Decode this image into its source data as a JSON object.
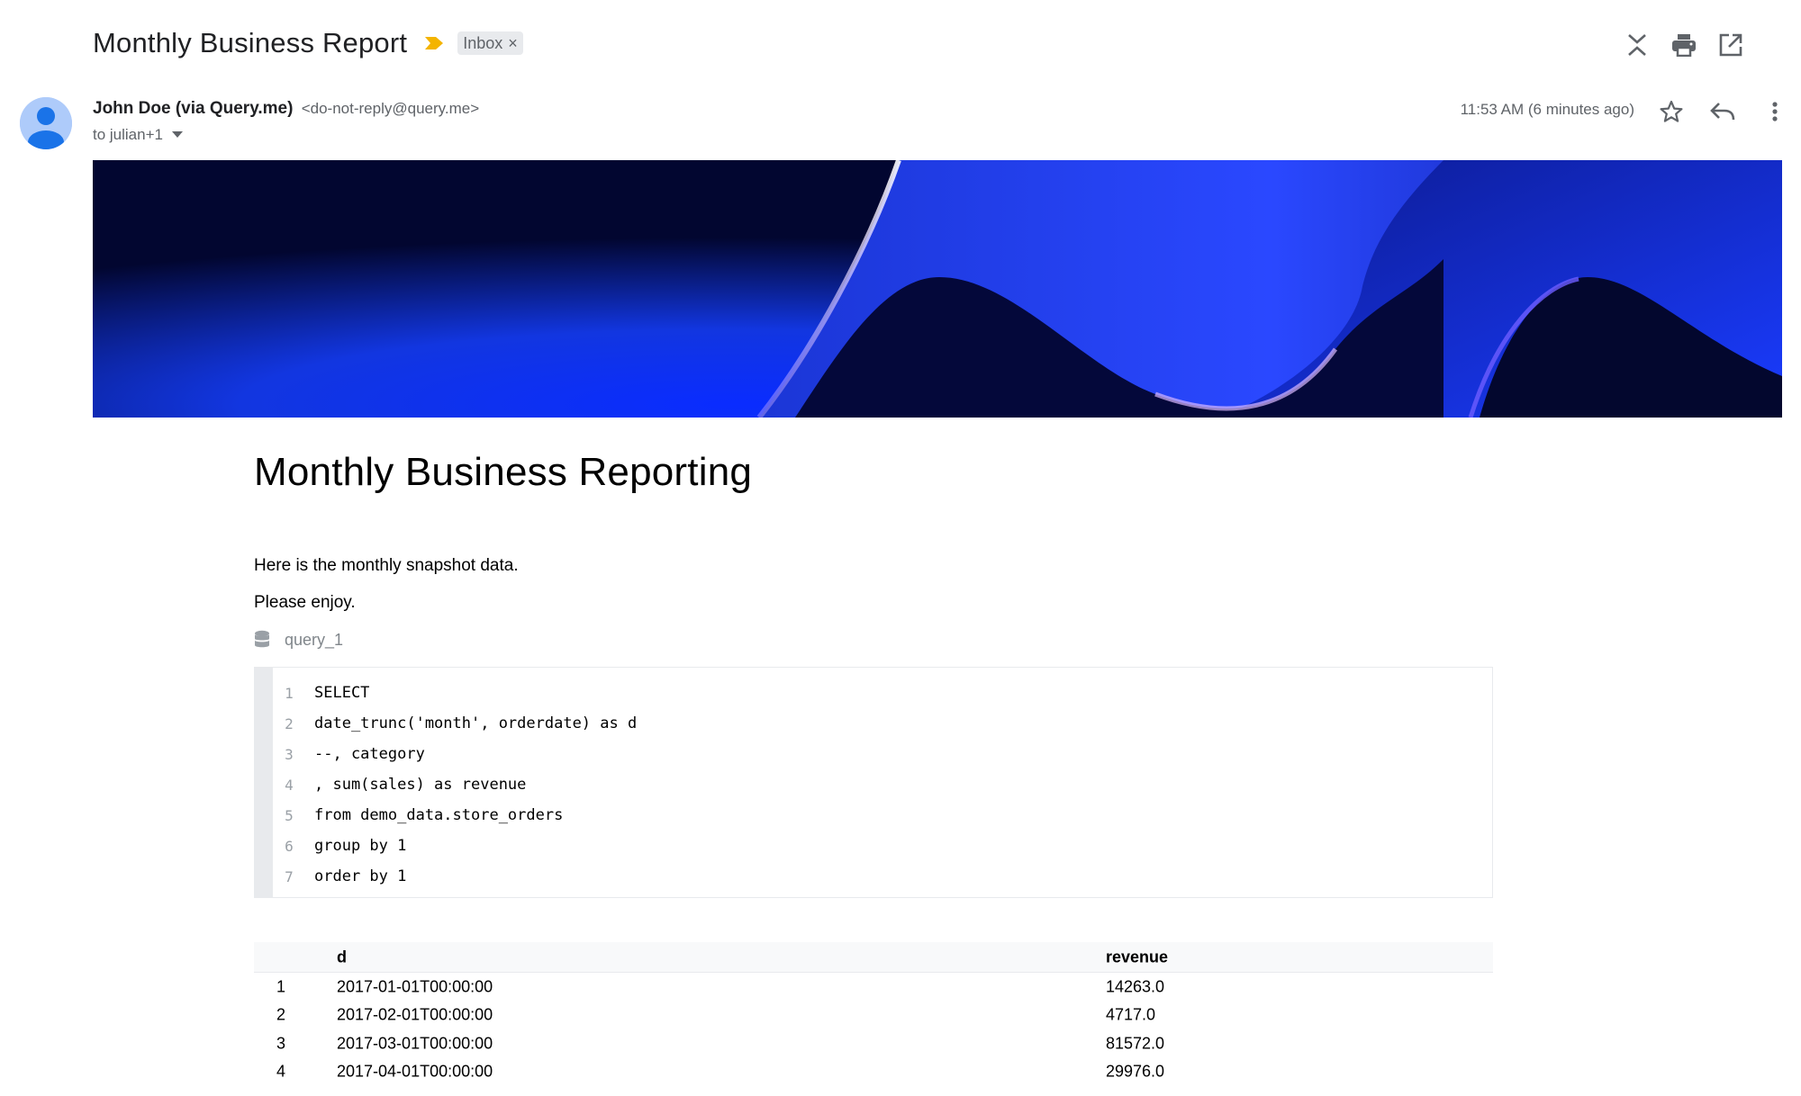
{
  "email": {
    "subject": "Monthly Business Report",
    "label_chip": "Inbox",
    "sender_name": "John Doe (via Query.me)",
    "sender_email": "<do-not-reply@query.me>",
    "recipients": "to julian+1",
    "timestamp": "11:53 AM (6 minutes ago)"
  },
  "icons": {
    "top": [
      "collapse-all-icon",
      "print-icon",
      "open-in-new-window-icon"
    ],
    "header": [
      "star-icon",
      "reply-icon",
      "more-vert-icon"
    ]
  },
  "colors": {
    "importance_marker": "#f4b400",
    "avatar_bg": "#aecbfa",
    "avatar_fg": "#1a73e8",
    "banner_dark": "#030a3a",
    "banner_bright": "#1438ff"
  },
  "body": {
    "heading": "Monthly Business Reporting",
    "intro": "Here is the monthly snapshot data.",
    "closing": "Please enjoy.",
    "query_name": "query_1",
    "code_lines": [
      {
        "num": "1",
        "text": "SELECT"
      },
      {
        "num": "2",
        "text": "date_trunc('month', orderdate) as d"
      },
      {
        "num": "3",
        "text": "--, category"
      },
      {
        "num": "4",
        "text": ", sum(sales) as revenue"
      },
      {
        "num": "5",
        "text": "from demo_data.store_orders"
      },
      {
        "num": "6",
        "text": "group by 1"
      },
      {
        "num": "7",
        "text": "order by 1"
      }
    ],
    "table": {
      "columns": [
        "d",
        "revenue"
      ],
      "rows": [
        {
          "idx": "1",
          "d": "2017-01-01T00:00:00",
          "revenue": "14263.0"
        },
        {
          "idx": "2",
          "d": "2017-02-01T00:00:00",
          "revenue": "4717.0"
        },
        {
          "idx": "3",
          "d": "2017-03-01T00:00:00",
          "revenue": "81572.0"
        },
        {
          "idx": "4",
          "d": "2017-04-01T00:00:00",
          "revenue": "29976.0"
        }
      ]
    }
  }
}
